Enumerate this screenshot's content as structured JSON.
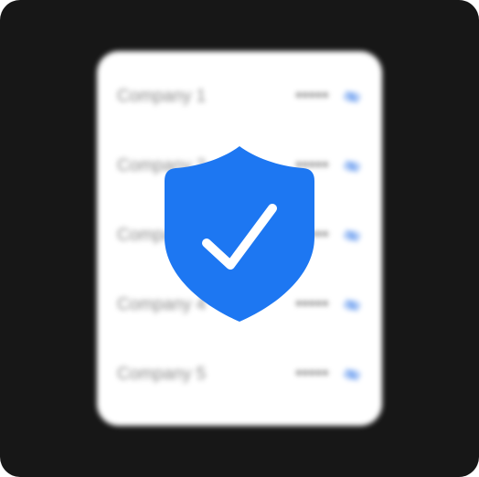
{
  "vault": {
    "entries": [
      {
        "company": "Company 1",
        "password_mask": "*****"
      },
      {
        "company": "Company 2",
        "password_mask": "*****"
      },
      {
        "company": "Company 3",
        "password_mask": "*****"
      },
      {
        "company": "Company 4",
        "password_mask": "*****"
      },
      {
        "company": "Company 5",
        "password_mask": "*****"
      }
    ],
    "visibility_icon": "eye-slash-icon"
  },
  "badge": {
    "icon": "shield-check-icon",
    "color": "#1D77F2",
    "check_color": "#FFFFFF"
  },
  "colors": {
    "background": "#171717",
    "card": "#FFFFFF",
    "text_muted": "#8A8A8A",
    "eye_icon": "#5B93EE"
  }
}
